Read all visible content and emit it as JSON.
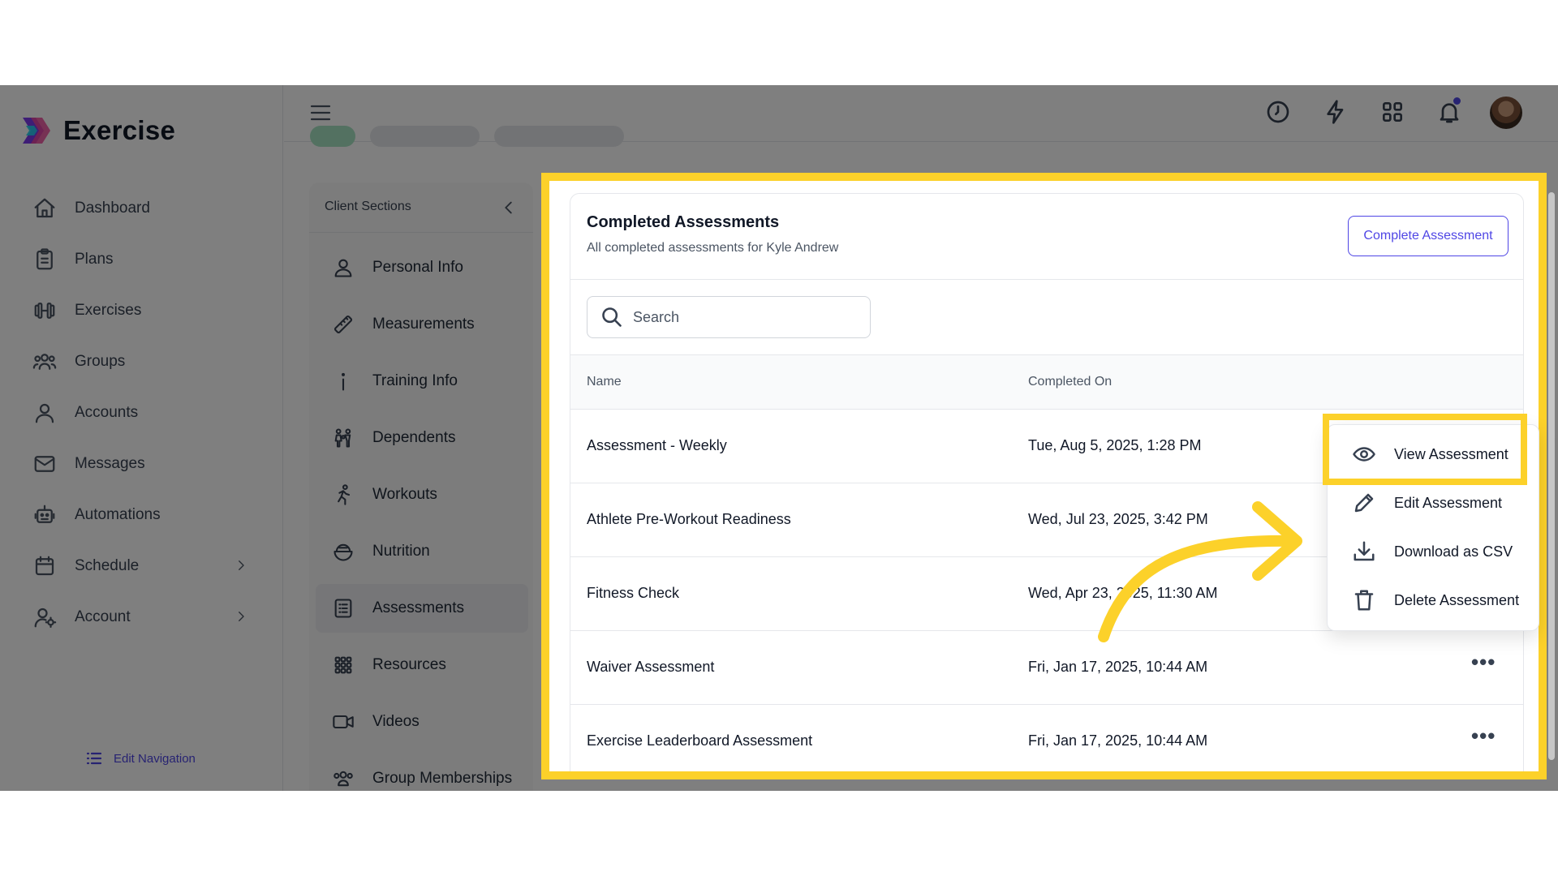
{
  "app": {
    "name": "Exercise"
  },
  "sidebar": {
    "items": [
      {
        "label": "Dashboard",
        "icon": "home-icon"
      },
      {
        "label": "Plans",
        "icon": "clipboard-icon"
      },
      {
        "label": "Exercises",
        "icon": "dumbbell-icon"
      },
      {
        "label": "Groups",
        "icon": "users-icon"
      },
      {
        "label": "Accounts",
        "icon": "user-icon"
      },
      {
        "label": "Messages",
        "icon": "mail-icon"
      },
      {
        "label": "Automations",
        "icon": "robot-icon"
      },
      {
        "label": "Schedule",
        "icon": "calendar-icon",
        "has_submenu": true
      },
      {
        "label": "Account",
        "icon": "user-cog-icon",
        "has_submenu": true
      }
    ],
    "edit_navigation_label": "Edit Navigation"
  },
  "header": {
    "icons": [
      "clock-icon",
      "bolt-icon",
      "grid-icon",
      "bell-icon"
    ],
    "has_notification": true
  },
  "client_sections": {
    "title": "Client Sections",
    "items": [
      {
        "label": "Personal Info",
        "icon": "person-icon"
      },
      {
        "label": "Measurements",
        "icon": "ruler-icon"
      },
      {
        "label": "Training Info",
        "icon": "info-icon"
      },
      {
        "label": "Dependents",
        "icon": "family-icon"
      },
      {
        "label": "Workouts",
        "icon": "running-icon"
      },
      {
        "label": "Nutrition",
        "icon": "bowl-icon"
      },
      {
        "label": "Assessments",
        "icon": "checklist-icon",
        "active": true
      },
      {
        "label": "Resources",
        "icon": "grid-dots-icon"
      },
      {
        "label": "Videos",
        "icon": "video-icon"
      },
      {
        "label": "Group Memberships",
        "icon": "group-icon"
      }
    ]
  },
  "assessments": {
    "title": "Completed Assessments",
    "subtitle": "All completed assessments for Kyle Andrew",
    "complete_button": "Complete Assessment",
    "search_placeholder": "Search",
    "columns": {
      "name": "Name",
      "completed_on": "Completed On"
    },
    "rows": [
      {
        "name": "Assessment - Weekly",
        "completed_on": "Tue, Aug 5, 2025, 1:28 PM"
      },
      {
        "name": "Athlete Pre-Workout Readiness",
        "completed_on": "Wed, Jul 23, 2025, 3:42 PM"
      },
      {
        "name": "Fitness Check",
        "completed_on": "Wed, Apr 23, 2025, 11:30 AM"
      },
      {
        "name": "Waiver Assessment",
        "completed_on": "Fri, Jan 17, 2025, 10:44 AM"
      },
      {
        "name": "Exercise Leaderboard Assessment",
        "completed_on": "Fri, Jan 17, 2025, 10:44 AM"
      }
    ],
    "row_menu": [
      {
        "label": "View Assessment",
        "icon": "eye-icon"
      },
      {
        "label": "Edit Assessment",
        "icon": "pencil-icon"
      },
      {
        "label": "Download as CSV",
        "icon": "download-icon"
      },
      {
        "label": "Delete Assessment",
        "icon": "trash-icon"
      }
    ]
  },
  "colors": {
    "accent": "#4f46e5",
    "highlight": "#fcd12a",
    "overlay": "rgba(0,0,0,0.5)"
  }
}
